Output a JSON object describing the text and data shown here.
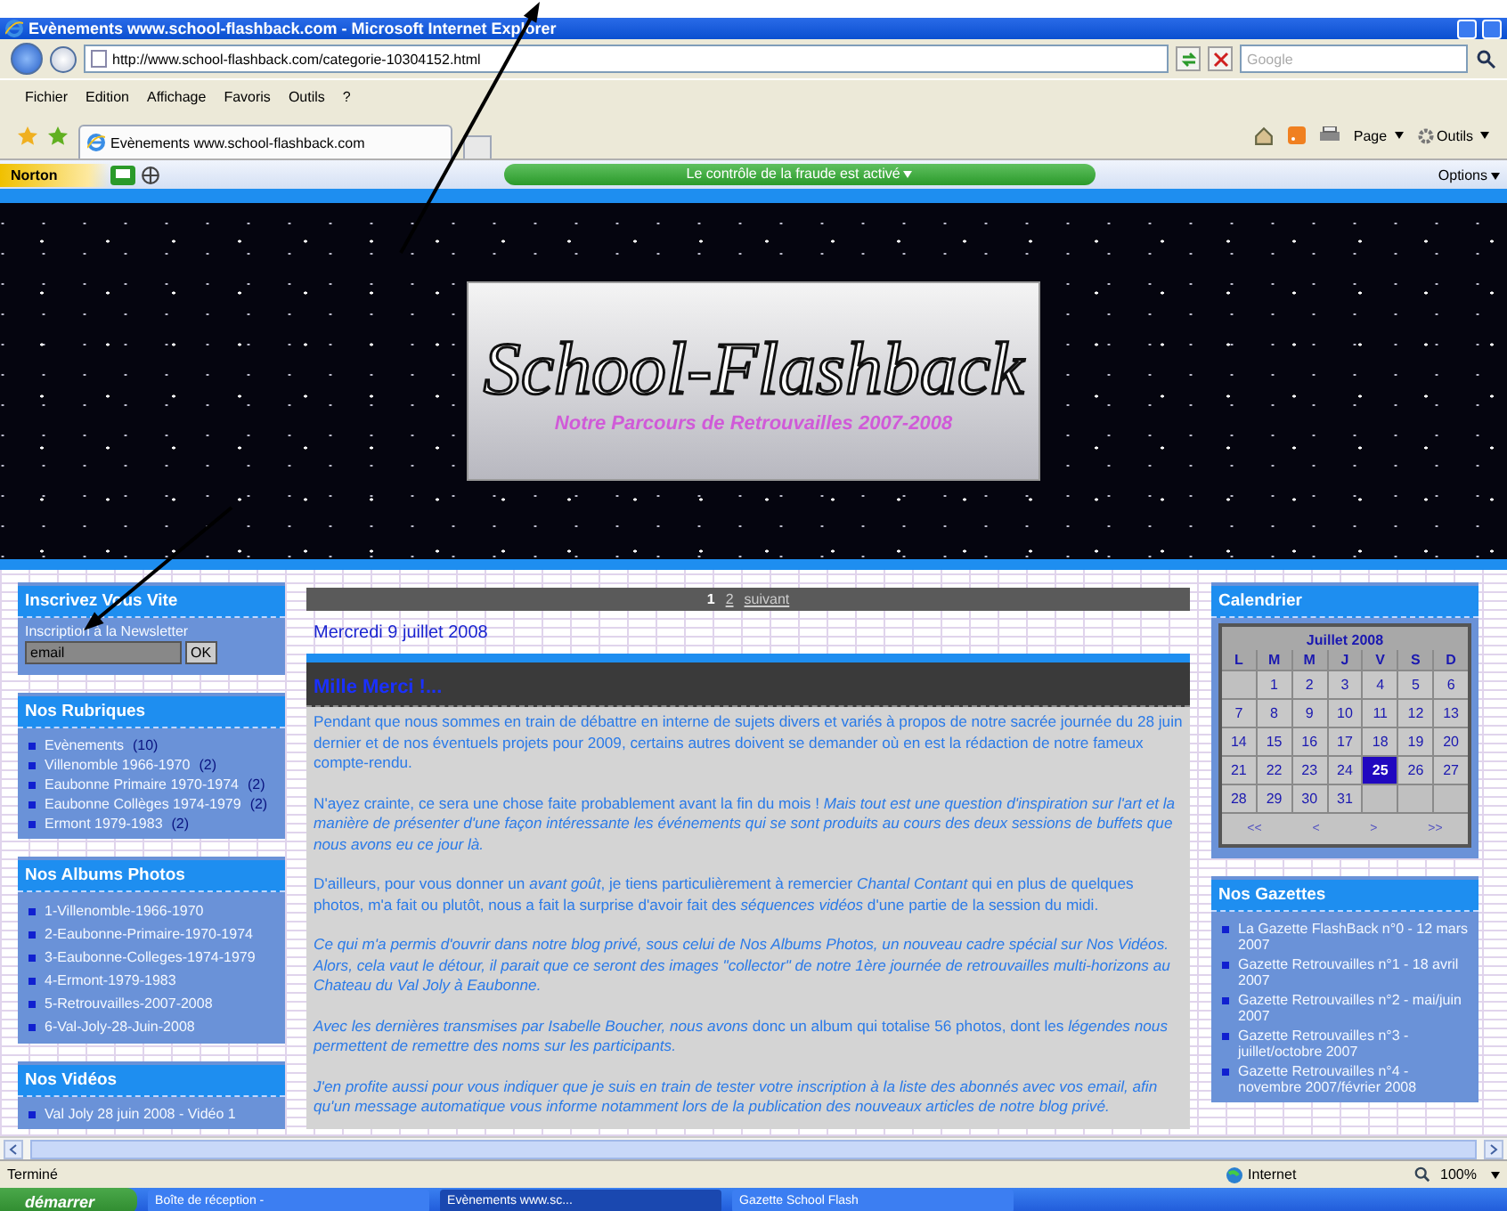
{
  "window": {
    "title": "Evènements www.school-flashback.com - Microsoft Internet Explorer"
  },
  "address_bar": {
    "url": "http://www.school-flashback.com/categorie-10304152.html",
    "search_placeholder": "Google"
  },
  "menu": [
    "Fichier",
    "Edition",
    "Affichage",
    "Favoris",
    "Outils",
    "?"
  ],
  "tabs": [
    {
      "label": "Evènements www.school-flashback.com",
      "selected": true
    }
  ],
  "command_bar": {
    "page": "Page",
    "tools": "Outils"
  },
  "norton": {
    "brand": "Norton",
    "status": "Le contrôle de la fraude est activé",
    "options": "Options"
  },
  "banner": {
    "title": "School-Flashback",
    "subtitle": "Notre Parcours de Retrouvailles 2007-2008"
  },
  "left_sidebar": [
    {
      "kind": "newsletter",
      "title": "Inscrivez Vous Vite",
      "label": "Inscription à la Newsletter",
      "value": "email",
      "button": "OK"
    },
    {
      "kind": "list",
      "title": "Nos Rubriques",
      "items": [
        {
          "label": "Evènements",
          "count": "(10)"
        },
        {
          "label": "Villenomble 1966-1970",
          "count": "(2)"
        },
        {
          "label": "Eaubonne Primaire 1970-1974",
          "count": "(2)"
        },
        {
          "label": "Eaubonne Collèges 1974-1979",
          "count": "(2)"
        },
        {
          "label": "Ermont 1979-1983",
          "count": "(2)"
        }
      ]
    },
    {
      "kind": "list",
      "title": "Nos Albums Photos",
      "items": [
        {
          "label": "1-Villenomble-1966-1970"
        },
        {
          "label": "2-Eaubonne-Primaire-1970-1974"
        },
        {
          "label": "3-Eaubonne-Colleges-1974-1979"
        },
        {
          "label": "4-Ermont-1979-1983"
        },
        {
          "label": "5-Retrouvailles-2007-2008"
        },
        {
          "label": "6-Val-Joly-28-Juin-2008"
        }
      ]
    },
    {
      "kind": "list",
      "title": "Nos Vidéos",
      "items": [
        {
          "label": "Val Joly 28 juin 2008 - Vidéo 1"
        }
      ]
    }
  ],
  "pagination": [
    {
      "label": "1",
      "selected": true
    },
    {
      "label": "2",
      "selected": false
    },
    {
      "label": "suivant",
      "selected": false
    }
  ],
  "post": {
    "date": "Mercredi 9 juillet 2008",
    "title": "Mille Merci !...",
    "paragraphs": [
      "Pendant que nous sommes en train de débattre en interne de sujets divers et variés à propos de notre sacrée journée du 28 juin dernier et de nos éventuels projets pour 2009, certains autres doivent se demander où en est la rédaction de notre fameux compte-rendu.",
      "N'ayez crainte, ce sera une chose faite probablement avant la fin du mois ! *Mais tout est une question d'inspiration sur l'art et la manière de présenter d'une façon intéressante les événements qui se sont produits au cours des deux sessions de buffets que nous avons eu ce jour là.*",
      "D'ailleurs, pour vous donner un *avant goût*, je tiens particulièrement à remercier *Chantal Contant* qui en plus de quelques photos, m'a fait ou plutôt, nous a fait la surprise d'avoir fait des *séquences vidéos* d'une partie de la session du midi.",
      "*Ce qui m'a permis d'ouvrir dans notre blog privé, sous celui de Nos Albums Photos, un nouveau cadre spécial sur Nos Vidéos. Alors, cela vaut le détour, il parait que ce seront des images \"collector\" de notre 1ère journée de retrouvailles multi-horizons au Chateau du Val Joly à Eaubonne.*",
      "*Avec les dernières transmises par Isabelle Boucher, nous avons* donc un album qui totalise 56 photos, dont les *légendes nous permettent de remettre des noms sur les participants.*",
      "*J'en profite aussi pour vous indiquer que je suis en train de tester votre inscription à la liste des abonnés avec vos email, afin qu'un message automatique vous informe notamment lors de la publication des nouveaux articles de notre blog privé.*"
    ]
  },
  "calendar": {
    "title": "Calendrier",
    "month": "Juillet 2008",
    "weekdays": [
      "L",
      "M",
      "M",
      "J",
      "V",
      "S",
      "D"
    ],
    "weeks": [
      [
        {
          "kind": "empty"
        },
        {
          "day": "1",
          "selected": false
        },
        {
          "day": "2",
          "selected": false
        },
        {
          "day": "3",
          "selected": false
        },
        {
          "day": "4",
          "selected": false
        },
        {
          "day": "5",
          "selected": false
        },
        {
          "day": "6",
          "selected": false
        }
      ],
      [
        {
          "day": "7",
          "selected": false
        },
        {
          "day": "8",
          "selected": false
        },
        {
          "day": "9",
          "selected": false
        },
        {
          "day": "10",
          "selected": false
        },
        {
          "day": "11",
          "selected": false
        },
        {
          "day": "12",
          "selected": false
        },
        {
          "day": "13",
          "selected": false
        }
      ],
      [
        {
          "day": "14",
          "selected": false
        },
        {
          "day": "15",
          "selected": false
        },
        {
          "day": "16",
          "selected": false
        },
        {
          "day": "17",
          "selected": false
        },
        {
          "day": "18",
          "selected": false
        },
        {
          "day": "19",
          "selected": false
        },
        {
          "day": "20",
          "selected": false
        }
      ],
      [
        {
          "day": "21",
          "selected": false
        },
        {
          "day": "22",
          "selected": false
        },
        {
          "day": "23",
          "selected": false
        },
        {
          "day": "24",
          "selected": false
        },
        {
          "day": "25",
          "selected": true
        },
        {
          "day": "26",
          "selected": false
        },
        {
          "day": "27",
          "selected": false
        }
      ],
      [
        {
          "day": "28",
          "selected": false
        },
        {
          "day": "29",
          "selected": false
        },
        {
          "day": "30",
          "selected": false
        },
        {
          "day": "31",
          "selected": false
        },
        {
          "kind": "empty"
        },
        {
          "kind": "empty"
        },
        {
          "kind": "empty"
        }
      ]
    ],
    "nav": [
      "<<",
      "<",
      ">",
      ">>"
    ]
  },
  "gazettes": {
    "title": "Nos Gazettes",
    "items": [
      "La Gazette FlashBack n°0 - 12 mars 2007",
      "Gazette Retrouvailles n°1 - 18 avril 2007",
      "Gazette Retrouvailles n°2 - mai/juin 2007",
      "Gazette Retrouvailles n°3 - juillet/octobre 2007",
      "Gazette Retrouvailles n°4 - novembre 2007/février 2008"
    ]
  },
  "status_bar": {
    "text": "Terminé",
    "zone": "Internet",
    "zoom": "100%"
  },
  "taskbar": {
    "start": "démarrer",
    "windows": [
      {
        "label": "Boîte de réception -",
        "selected": false
      },
      {
        "label": "Evènements www.sc...",
        "selected": true
      },
      {
        "label": "Gazette School Flash",
        "selected": false
      }
    ]
  }
}
